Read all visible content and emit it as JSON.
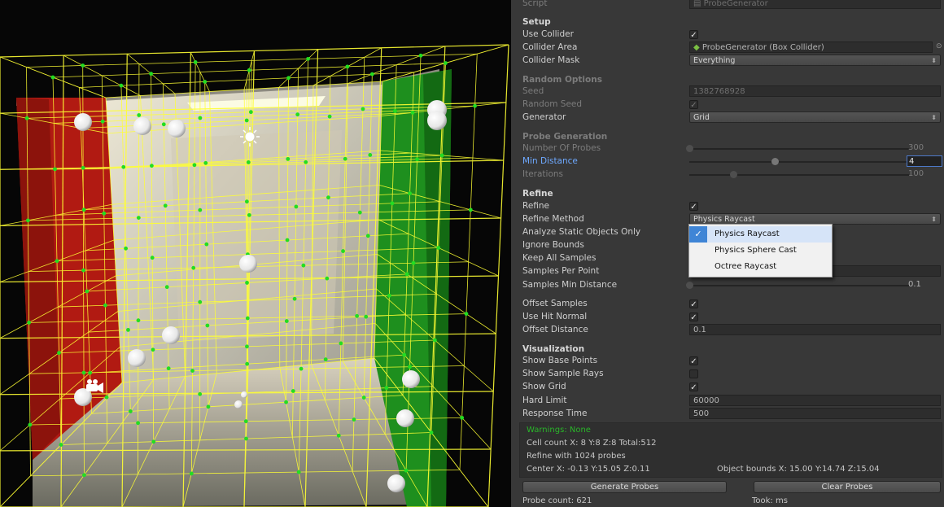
{
  "script_row": {
    "label": "Script",
    "value": "ProbeGenerator"
  },
  "sections": {
    "setup": "Setup",
    "random_options": "Random Options",
    "probe_generation": "Probe Generation",
    "refine": "Refine",
    "visualization": "Visualization"
  },
  "fields": {
    "use_collider": {
      "label": "Use Collider",
      "checked": true
    },
    "collider_area": {
      "label": "Collider Area",
      "value": "ProbeGenerator (Box Collider)"
    },
    "collider_mask": {
      "label": "Collider Mask",
      "value": "Everything"
    },
    "seed": {
      "label": "Seed",
      "value": "1382768928"
    },
    "random_seed": {
      "label": "Random Seed",
      "checked": true
    },
    "generator": {
      "label": "Generator",
      "value": "Grid"
    },
    "number_of_probes": {
      "label": "Number Of Probes",
      "value": "300",
      "fraction": 0.0
    },
    "min_distance": {
      "label": "Min Distance",
      "value": "4",
      "fraction": 0.39
    },
    "iterations": {
      "label": "Iterations",
      "value": "100",
      "fraction": 0.2
    },
    "refine": {
      "label": "Refine",
      "checked": true
    },
    "refine_method": {
      "label": "Refine Method",
      "value": "Physics Raycast"
    },
    "analyze_static": {
      "label": "Analyze Static Objects Only"
    },
    "ignore_bounds": {
      "label": "Ignore Bounds"
    },
    "keep_all_samples": {
      "label": "Keep All Samples"
    },
    "samples_per_point": {
      "label": "Samples Per Point"
    },
    "samples_min_distance": {
      "label": "Samples Min Distance",
      "value": "0.1",
      "fraction": 0.0
    },
    "offset_samples": {
      "label": "Offset Samples",
      "checked": true
    },
    "use_hit_normal": {
      "label": "Use Hit Normal",
      "checked": true
    },
    "offset_distance": {
      "label": "Offset Distance",
      "value": "0.1"
    },
    "show_base_points": {
      "label": "Show Base Points",
      "checked": true
    },
    "show_sample_rays": {
      "label": "Show Sample Rays",
      "checked": false
    },
    "show_grid": {
      "label": "Show Grid",
      "checked": true
    },
    "hard_limit": {
      "label": "Hard Limit",
      "value": "60000"
    },
    "response_time": {
      "label": "Response Time",
      "value": "500"
    }
  },
  "dropdown_popup": {
    "options": [
      "Physics Raycast",
      "Physics Sphere Cast",
      "Octree Raycast"
    ],
    "selected": "Physics Raycast"
  },
  "info": {
    "warnings": "Warnings: None",
    "cell_count": "Cell count X: 8 Y:8 Z:8 Total:512",
    "refine_with": "Refine with 1024 probes",
    "center": "Center X: -0.13 Y:15.05 Z:0.11",
    "object_bounds": "Object bounds X: 15.00 Y:14.74 Z:15.04"
  },
  "buttons": {
    "generate": "Generate Probes",
    "clear": "Clear Probes"
  },
  "footer": {
    "probe_count": "Probe count: 621",
    "took": "Took: ms"
  },
  "colors": {
    "inspector_bg": "#383838",
    "grid_lines": "#ffff33",
    "probe_points": "#22dd22",
    "red_wall": "#b11a12",
    "green_wall": "#1e8f1e",
    "warning_text": "#29b529",
    "selection_blue": "#3f85d6"
  }
}
